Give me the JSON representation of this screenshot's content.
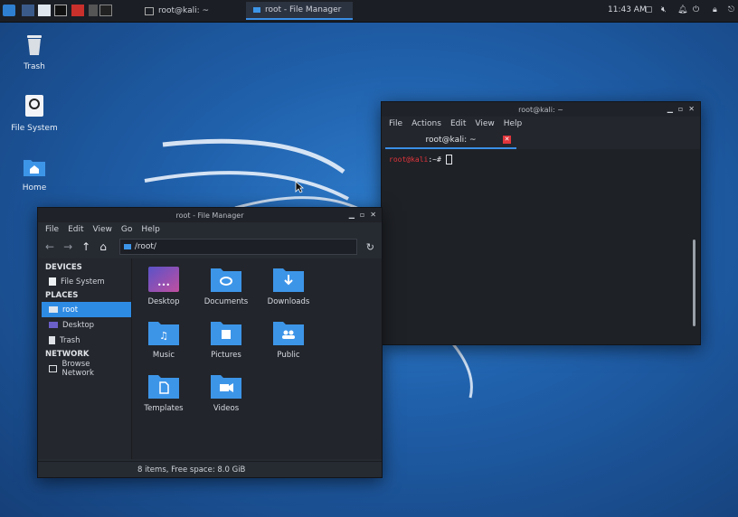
{
  "taskbar": {
    "tasks": [
      {
        "label": "root@kali: ~"
      },
      {
        "label": "root - File Manager"
      }
    ],
    "clock": "11:43 AM"
  },
  "desktop": {
    "icons": [
      {
        "label": "Trash"
      },
      {
        "label": "File System"
      },
      {
        "label": "Home"
      }
    ]
  },
  "file_manager": {
    "title": "root - File Manager",
    "menu": [
      "File",
      "Edit",
      "View",
      "Go",
      "Help"
    ],
    "path": "/root/",
    "sidebar": {
      "devices_header": "DEVICES",
      "devices": [
        {
          "label": "File System"
        }
      ],
      "places_header": "PLACES",
      "places": [
        {
          "label": "root"
        },
        {
          "label": "Desktop"
        },
        {
          "label": "Trash"
        }
      ],
      "network_header": "NETWORK",
      "network": [
        {
          "label": "Browse Network"
        }
      ]
    },
    "folders": [
      {
        "label": "Desktop"
      },
      {
        "label": "Documents"
      },
      {
        "label": "Downloads"
      },
      {
        "label": "Music"
      },
      {
        "label": "Pictures"
      },
      {
        "label": "Public"
      },
      {
        "label": "Templates"
      },
      {
        "label": "Videos"
      }
    ],
    "status": "8 items, Free space: 8.0 GiB"
  },
  "terminal": {
    "title": "root@kali: ~",
    "menu": [
      "File",
      "Actions",
      "Edit",
      "View",
      "Help"
    ],
    "tab_label": "root@kali: ~",
    "prompt_user": "root@kali",
    "prompt_rest": ":~# "
  },
  "colors": {
    "accent": "#2e8be4",
    "folder": "#3d95e8",
    "prompt_red": "#e0353b"
  }
}
